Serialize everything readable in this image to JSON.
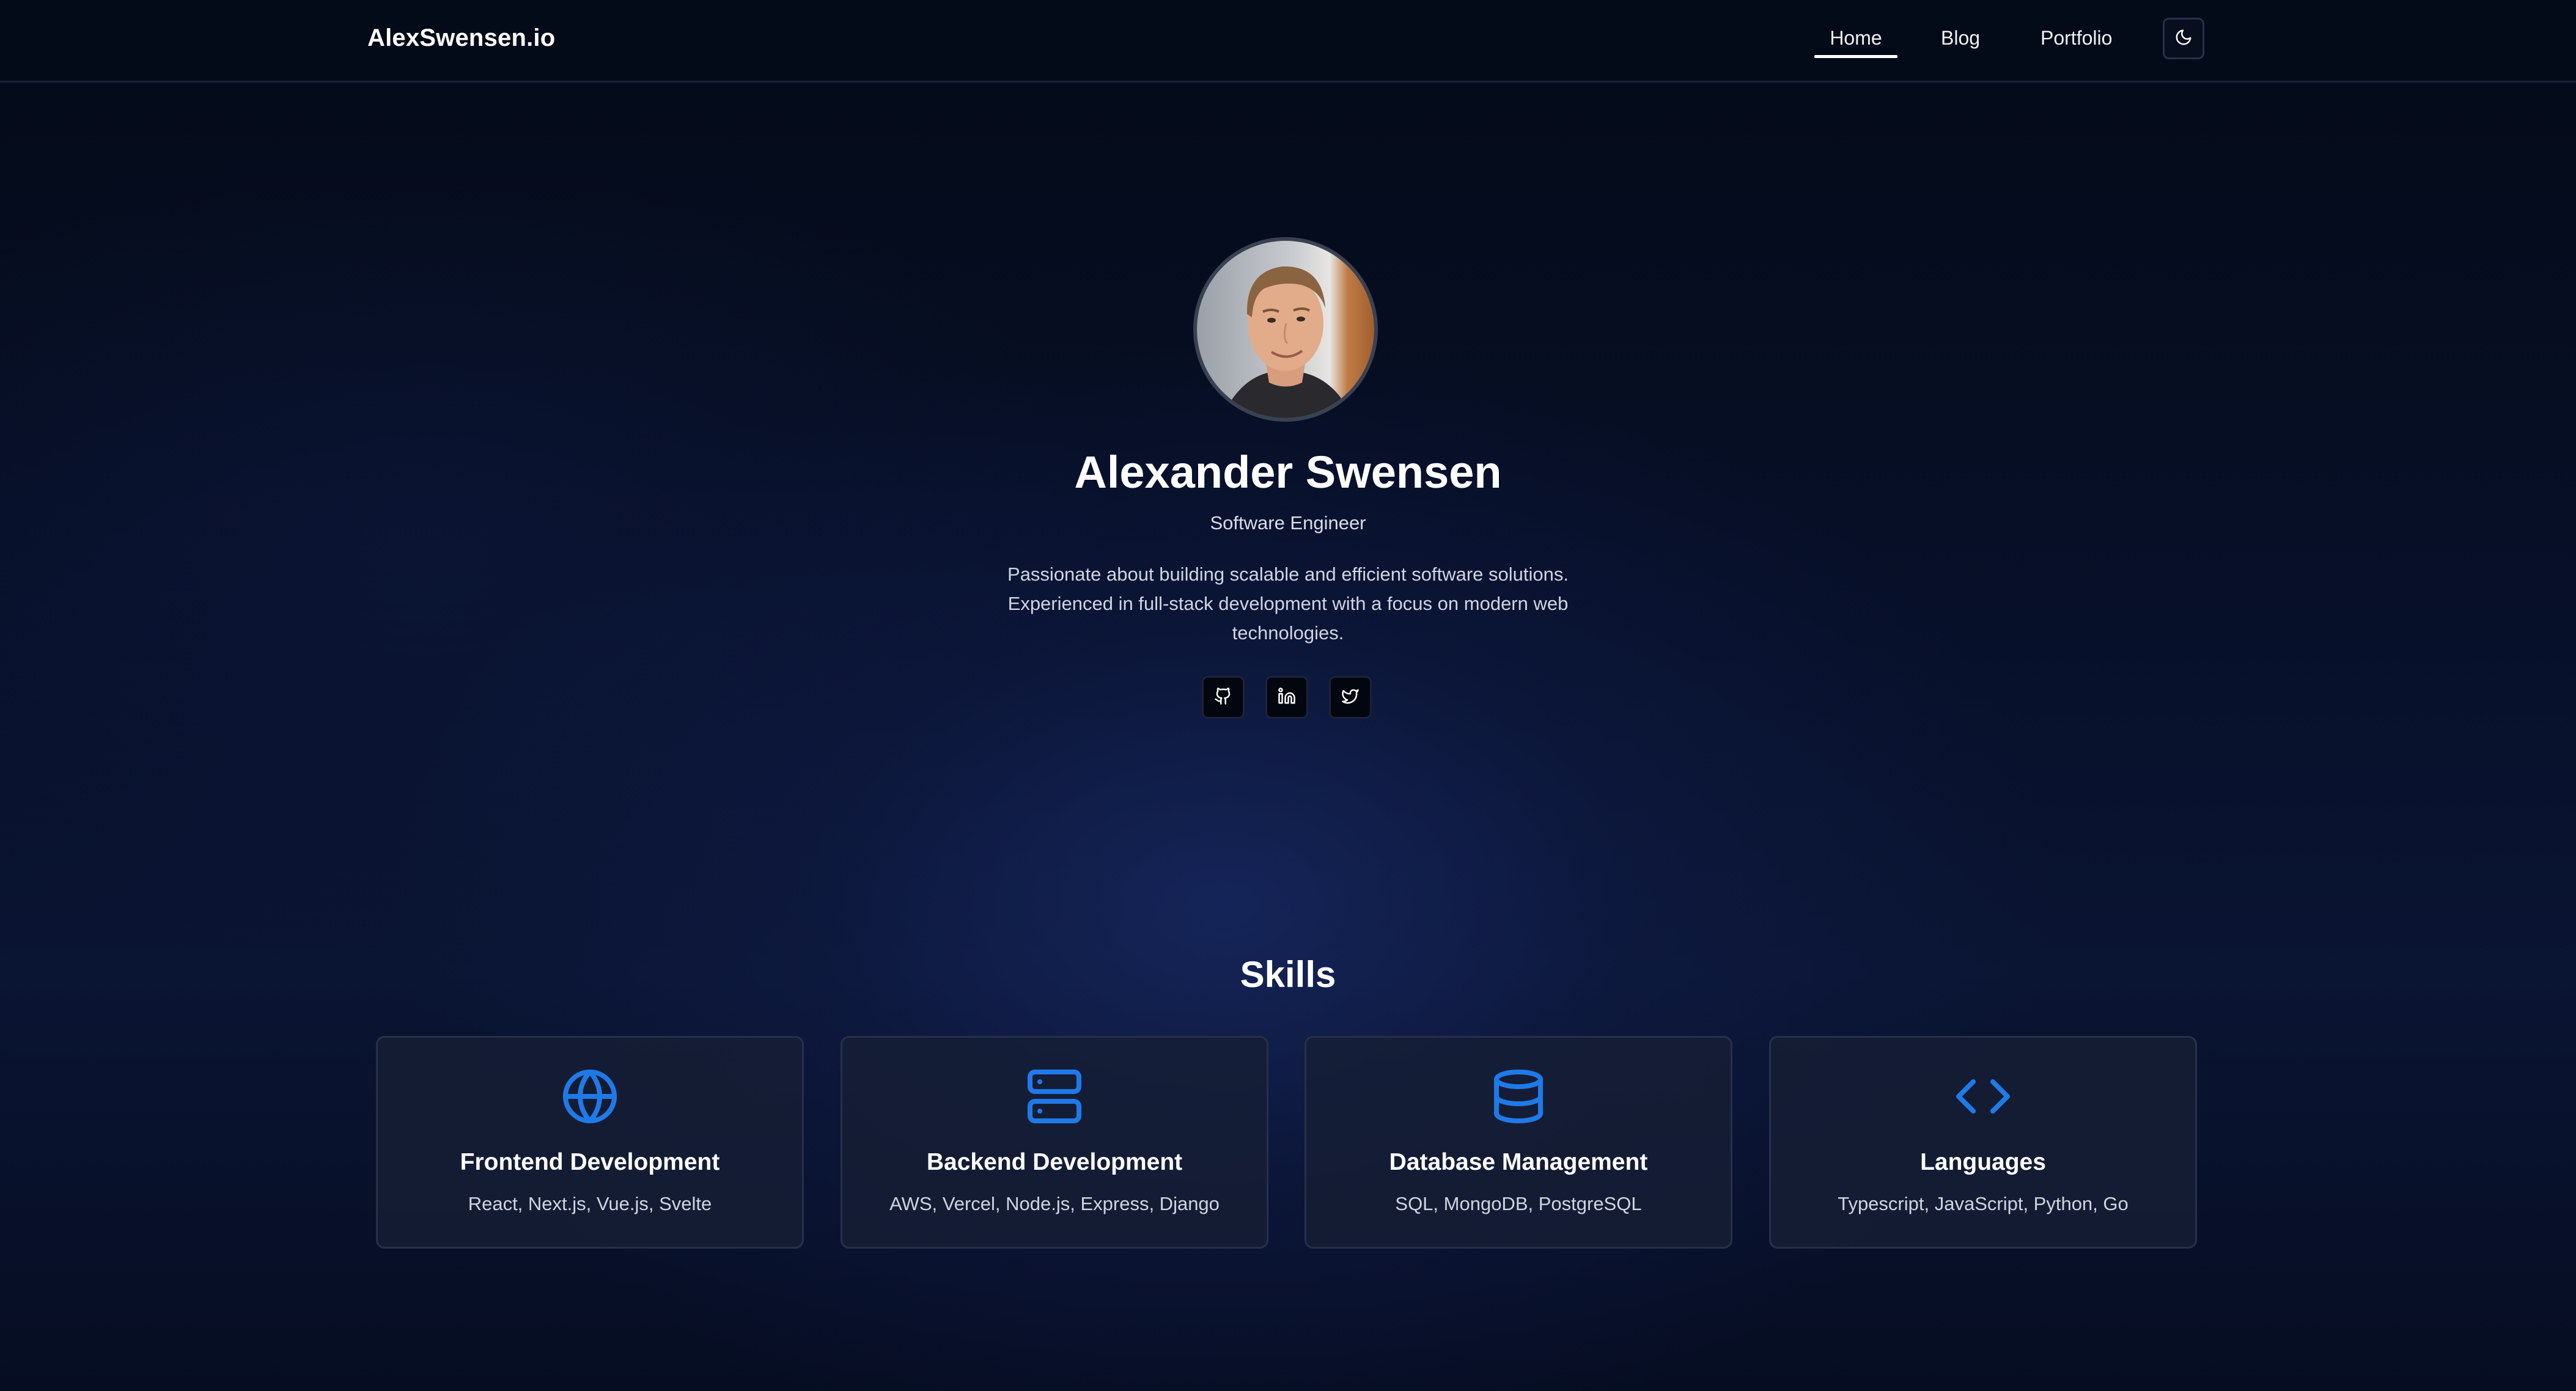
{
  "header": {
    "brand": "AlexSwensen.io",
    "nav": [
      {
        "label": "Home",
        "active": true
      },
      {
        "label": "Blog",
        "active": false
      },
      {
        "label": "Portfolio",
        "active": false
      }
    ],
    "theme_toggle_icon": "moon-icon"
  },
  "hero": {
    "name": "Alexander Swensen",
    "role": "Software Engineer",
    "bio": "Passionate about building scalable and efficient software solutions. Experienced in full-stack development with a focus on modern web technologies.",
    "social": [
      {
        "icon": "github-icon"
      },
      {
        "icon": "linkedin-icon"
      },
      {
        "icon": "twitter-icon"
      }
    ]
  },
  "skills": {
    "title": "Skills",
    "cards": [
      {
        "icon": "globe-icon",
        "title": "Frontend Development",
        "desc": "React, Next.js, Vue.js, Svelte"
      },
      {
        "icon": "server-icon",
        "title": "Backend Development",
        "desc": "AWS, Vercel, Node.js, Express, Django"
      },
      {
        "icon": "database-icon",
        "title": "Database Management",
        "desc": "SQL, MongoDB, PostgreSQL"
      },
      {
        "icon": "code-icon",
        "title": "Languages",
        "desc": "Typescript, JavaScript, Python, Go"
      }
    ]
  },
  "colors": {
    "accent": "#1f7ae8",
    "background": "#050b1b",
    "card": "#161e34"
  }
}
